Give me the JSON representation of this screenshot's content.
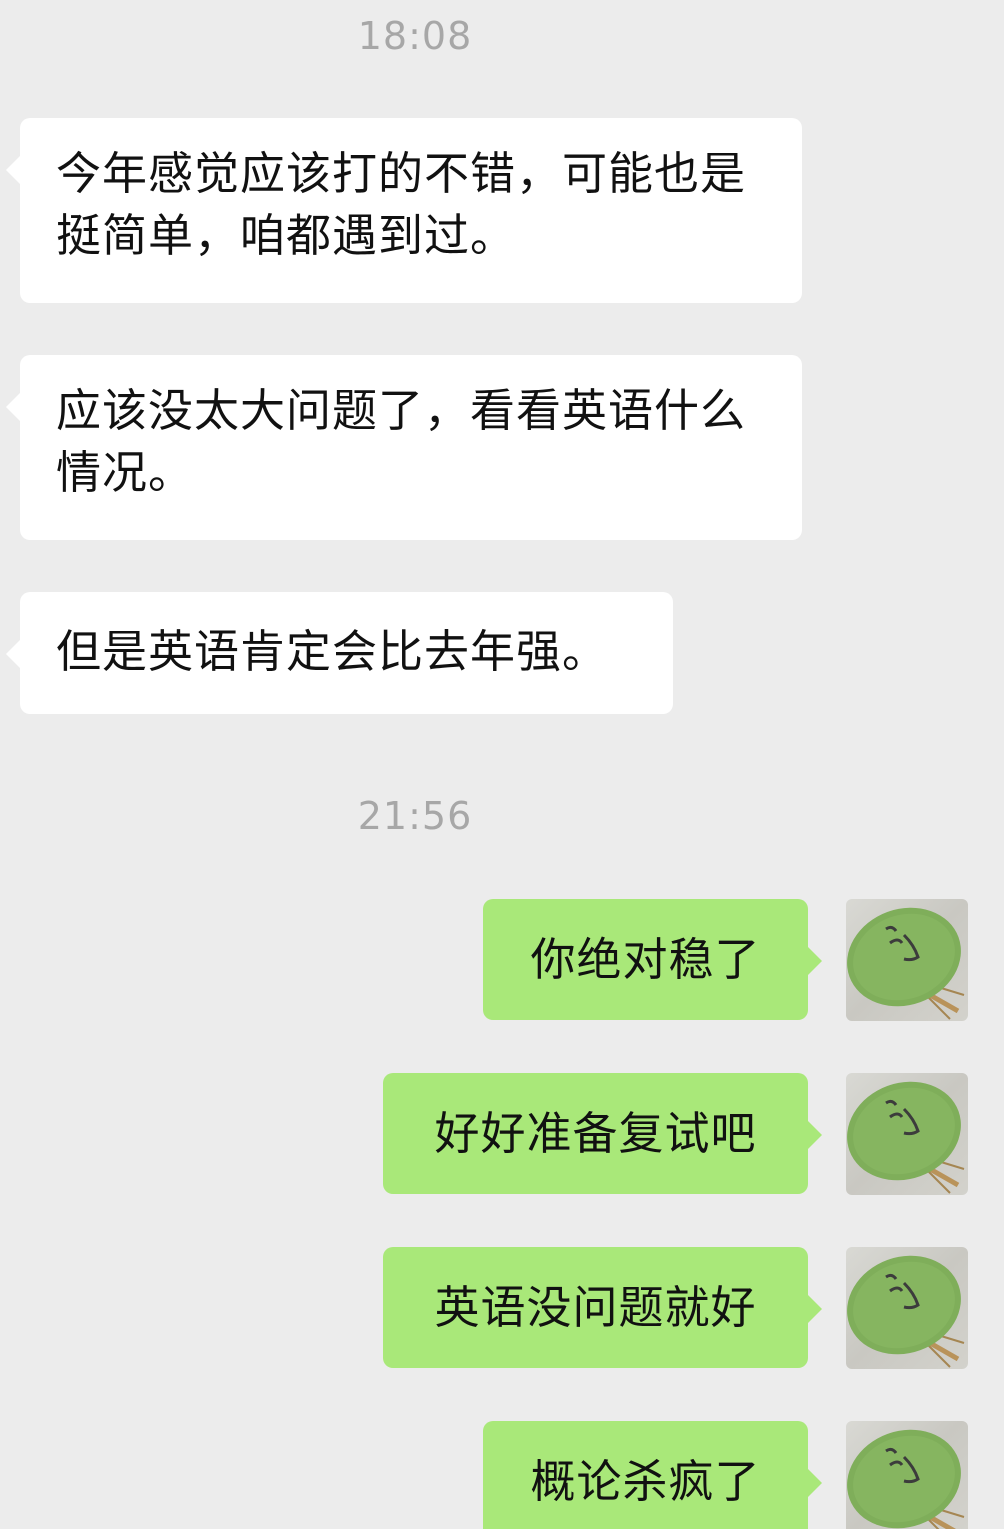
{
  "chat": {
    "timestamps": [
      "18:08",
      "21:56"
    ],
    "incoming": [
      "今年感觉应该打的不错，可能也是挺简单，咱都遇到过。",
      "应该没太大问题了，看看英语什么情况。",
      "但是英语肯定会比去年强。"
    ],
    "outgoing": [
      "你绝对稳了",
      "好好准备复试吧",
      "英语没问题就好",
      "概论杀疯了"
    ]
  },
  "colors": {
    "background": "#ececec",
    "incoming_bubble": "#ffffff",
    "outgoing_bubble": "#a9e879",
    "timestamp_text": "#a7a7a7"
  },
  "icons": [
    "fan-avatar-icon"
  ]
}
